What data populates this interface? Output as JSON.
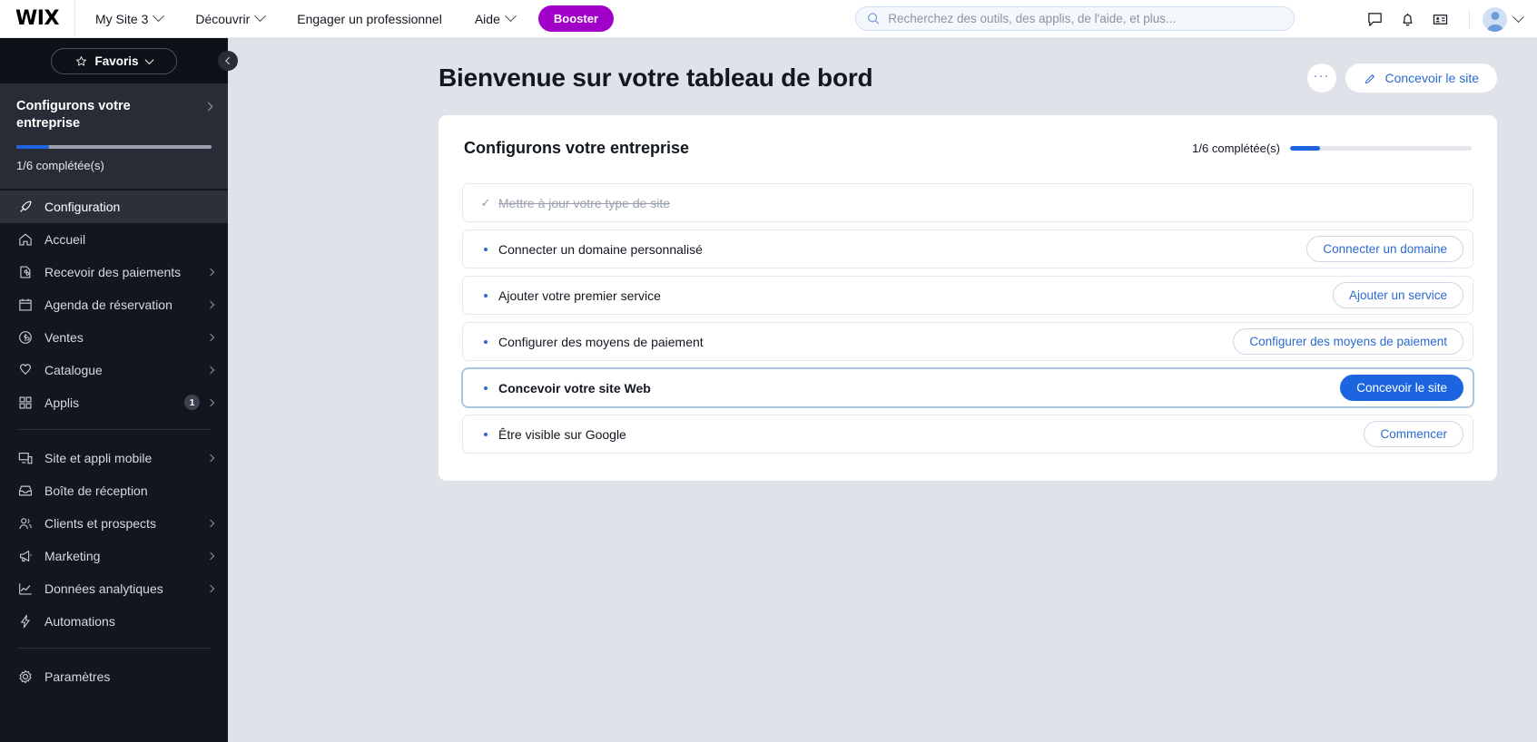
{
  "topbar": {
    "logo": "WIX",
    "nav": [
      {
        "label": "My Site 3",
        "caret": true
      },
      {
        "label": "Découvrir",
        "caret": true
      },
      {
        "label": "Engager un professionnel",
        "caret": false
      },
      {
        "label": "Aide",
        "caret": true
      }
    ],
    "booster_label": "Booster",
    "search": {
      "placeholder": "Recherchez des outils, des applis, de l'aide, et plus...",
      "value": ""
    },
    "icons": [
      "chat-icon",
      "bell-icon",
      "contact-card-icon",
      "avatar"
    ]
  },
  "sidebar": {
    "favorites_label": "Favoris",
    "setup": {
      "title": "Configurons votre entreprise",
      "progress_text": "1/6 complétée(s)",
      "progress_percent": 16.6
    },
    "items": [
      {
        "label": "Configuration",
        "icon": "rocket-icon",
        "active": true,
        "caret": false,
        "badge": ""
      },
      {
        "label": "Accueil",
        "icon": "home-icon",
        "active": false,
        "caret": false,
        "badge": ""
      },
      {
        "label": "Recevoir des paiements",
        "icon": "payments-icon",
        "active": false,
        "caret": true,
        "badge": ""
      },
      {
        "label": "Agenda de réservation",
        "icon": "calendar-icon",
        "active": false,
        "caret": true,
        "badge": ""
      },
      {
        "label": "Ventes",
        "icon": "dollar-circle-icon",
        "active": false,
        "caret": true,
        "badge": ""
      },
      {
        "label": "Catalogue",
        "icon": "catalog-icon",
        "active": false,
        "caret": true,
        "badge": ""
      },
      {
        "label": "Applis",
        "icon": "grid-apps-icon",
        "active": false,
        "caret": true,
        "badge": "1"
      }
    ],
    "items2": [
      {
        "label": "Site et appli mobile",
        "icon": "devices-icon",
        "active": false,
        "caret": true,
        "badge": ""
      },
      {
        "label": "Boîte de réception",
        "icon": "inbox-icon",
        "active": false,
        "caret": false,
        "badge": ""
      },
      {
        "label": "Clients et prospects",
        "icon": "people-icon",
        "active": false,
        "caret": true,
        "badge": ""
      },
      {
        "label": "Marketing",
        "icon": "megaphone-icon",
        "active": false,
        "caret": true,
        "badge": ""
      },
      {
        "label": "Données analytiques",
        "icon": "chart-line-icon",
        "active": false,
        "caret": true,
        "badge": ""
      },
      {
        "label": "Automations",
        "icon": "bolt-icon",
        "active": false,
        "caret": false,
        "badge": ""
      }
    ],
    "items3": [
      {
        "label": "Paramètres",
        "icon": "gear-icon",
        "active": false,
        "caret": false,
        "badge": ""
      }
    ]
  },
  "page": {
    "title": "Bienvenue sur votre tableau de bord",
    "more_label": "···",
    "design_button": "Concevoir le site"
  },
  "card": {
    "title": "Configurons votre entreprise",
    "progress_text": "1/6 complétée(s)",
    "progress_percent": 16.6,
    "items": [
      {
        "label": "Mettre à jour votre type de site",
        "done": true,
        "highlight": false,
        "bold": false,
        "button": ""
      },
      {
        "label": "Connecter un domaine personnalisé",
        "done": false,
        "highlight": false,
        "bold": false,
        "button": "Connecter un domaine",
        "primary": false
      },
      {
        "label": "Ajouter votre premier service",
        "done": false,
        "highlight": false,
        "bold": false,
        "button": "Ajouter un service",
        "primary": false
      },
      {
        "label": "Configurer des moyens de paiement",
        "done": false,
        "highlight": false,
        "bold": false,
        "button": "Configurer des moyens de paiement",
        "primary": false
      },
      {
        "label": "Concevoir votre site Web",
        "done": false,
        "highlight": true,
        "bold": true,
        "button": "Concevoir le site",
        "primary": true
      },
      {
        "label": "Être visible sur Google",
        "done": false,
        "highlight": false,
        "bold": false,
        "button": "Commencer",
        "primary": false
      }
    ]
  },
  "colors": {
    "accent_blue": "#1d64e0",
    "link_blue": "#2b6ad0",
    "booster_purple": "#a000c8",
    "sidebar_bg": "#12161f",
    "page_bg": "#dfe2e8"
  }
}
